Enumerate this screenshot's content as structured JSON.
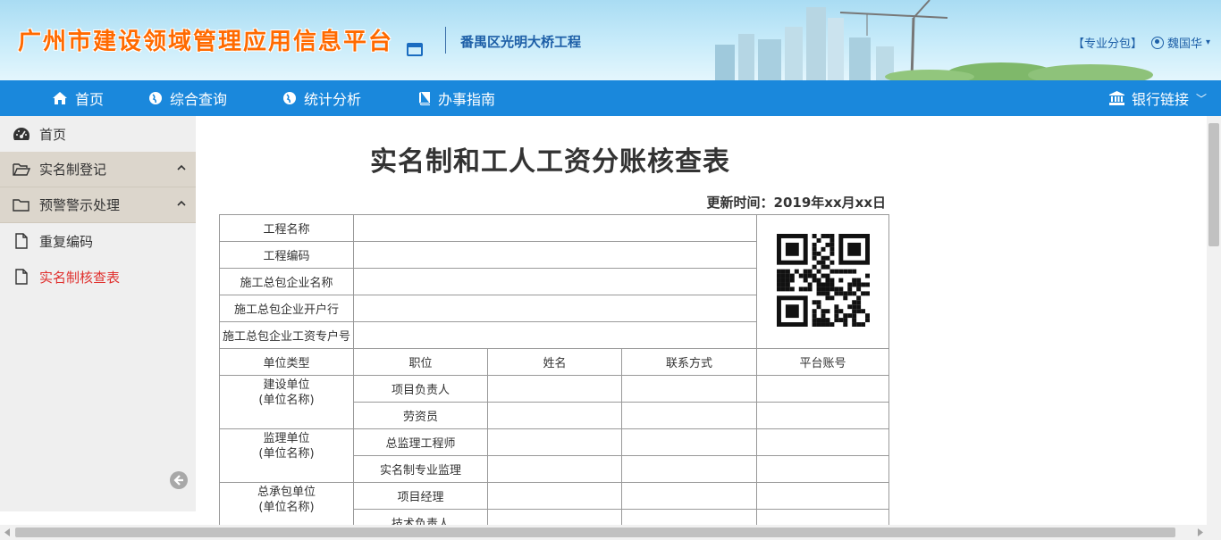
{
  "header": {
    "title": "广州市建设领域管理应用信息平台",
    "project": "番禺区光明大桥工程",
    "role": "【专业分包】",
    "user": "魏国华"
  },
  "nav": {
    "items": [
      {
        "label": "首页",
        "icon": "home-icon"
      },
      {
        "label": "综合查询",
        "icon": "globe-icon"
      },
      {
        "label": "统计分析",
        "icon": "globe-icon"
      },
      {
        "label": "办事指南",
        "icon": "book-icon"
      }
    ],
    "bank": "银行链接"
  },
  "sidebar": {
    "items": [
      {
        "label": "首页",
        "icon": "dashboard-icon"
      },
      {
        "label": "实名制登记",
        "icon": "folder-open-icon"
      },
      {
        "label": "预警警示处理",
        "icon": "folder-icon"
      },
      {
        "label": "重复编码",
        "icon": "file-icon"
      },
      {
        "label": "实名制核查表",
        "icon": "file-icon"
      }
    ]
  },
  "main": {
    "title": "实名制和工人工资分账核查表",
    "update_time": "更新时间：2019年xx月xx日",
    "info_rows": [
      "工程名称",
      "工程编码",
      "施工总包企业名称",
      "施工总包企业开户行",
      "施工总包企业工资专户号"
    ],
    "columns": [
      "单位类型",
      "职位",
      "姓名",
      "联系方式",
      "平台账号"
    ],
    "groups": [
      {
        "unit": "建设单位",
        "sub": "(单位名称)",
        "positions": [
          "项目负责人",
          "劳资员"
        ]
      },
      {
        "unit": "监理单位",
        "sub": "(单位名称)",
        "positions": [
          "总监理工程师",
          "实名制专业监理"
        ]
      },
      {
        "unit": "总承包单位",
        "sub": "(单位名称)",
        "positions": [
          "项目经理",
          "技术负责人"
        ]
      }
    ]
  },
  "colors": {
    "nav_bg": "#1a88dc",
    "title_orange": "#ff6a00",
    "active_red": "#e0302e"
  }
}
